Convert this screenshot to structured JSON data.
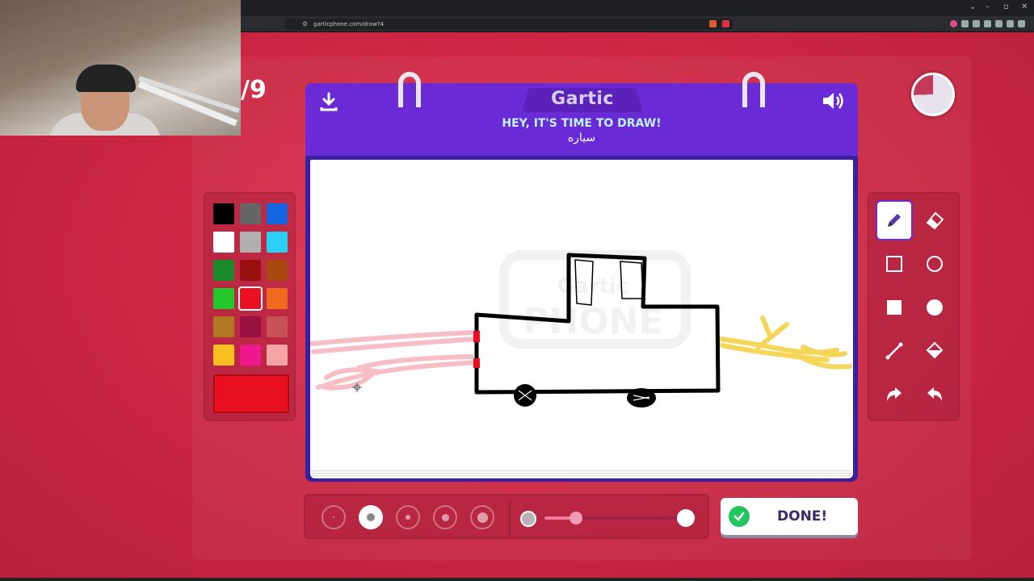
{
  "browser": {
    "url": "garticphone.com/draw?4"
  },
  "round_indicator": "/9",
  "header": {
    "logo": "Gartic",
    "prompt": "HEY, IT'S TIME TO DRAW!",
    "word": "سياره"
  },
  "palette": {
    "colors": [
      "#000000",
      "#666666",
      "#1565e0",
      "#ffffff",
      "#b0b0b0",
      "#2ad0f5",
      "#1a8a2a",
      "#9a1010",
      "#a84a10",
      "#22c82a",
      "#ea1020",
      "#f26a20",
      "#b07820",
      "#9a1040",
      "#c85058",
      "#f7c020",
      "#f01890",
      "#f5a4a4"
    ],
    "selected_index": 10,
    "current_color": "#e8101e"
  },
  "tools": {
    "items": [
      "pencil-icon",
      "eraser-icon",
      "square-outline-icon",
      "circle-outline-icon",
      "square-filled-icon",
      "circle-filled-icon",
      "line-icon",
      "fill-bucket-icon",
      "undo-icon",
      "redo-icon"
    ],
    "selected_index": 0
  },
  "brush": {
    "sizes": 5,
    "selected_size_index": 1,
    "opacity_fraction": 0.22
  },
  "done_button": {
    "label": "DONE!"
  },
  "accent": "#6a2bd6"
}
